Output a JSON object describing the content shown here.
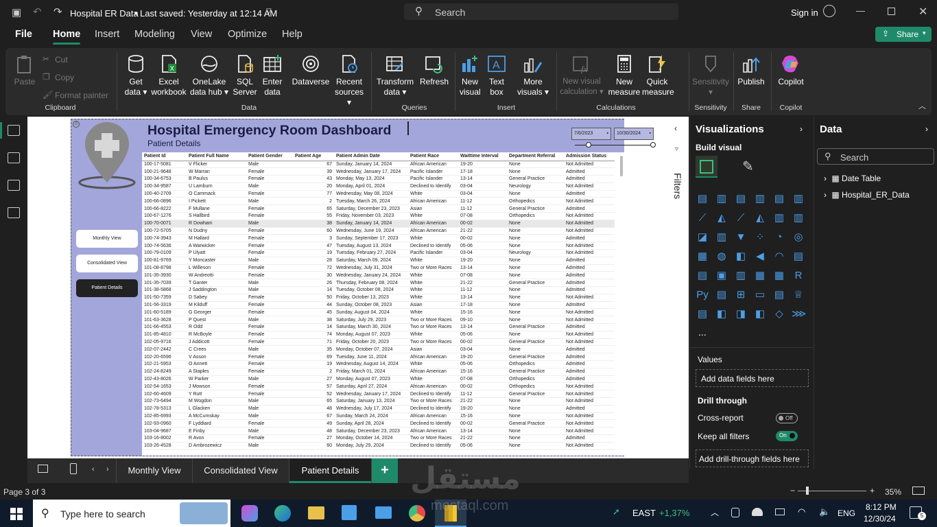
{
  "app": {
    "file_title": "Hospital ER Data",
    "save_status": "Last saved: Yesterday at 12:14 AM",
    "search_placeholder": "Search",
    "sign_in": "Sign in"
  },
  "menu": [
    "File",
    "Home",
    "Insert",
    "Modeling",
    "View",
    "Optimize",
    "Help"
  ],
  "share_label": "Share",
  "ribbon": {
    "clipboard": {
      "paste": "Paste",
      "cut": "Cut",
      "copy": "Copy",
      "format_painter": "Format painter",
      "group": "Clipboard"
    },
    "data": {
      "items": [
        {
          "l1": "Get",
          "l2": "data ▾"
        },
        {
          "l1": "Excel",
          "l2": "workbook"
        },
        {
          "l1": "OneLake",
          "l2": "data hub ▾"
        },
        {
          "l1": "SQL",
          "l2": "Server"
        },
        {
          "l1": "Enter",
          "l2": "data"
        },
        {
          "l1": "Dataverse",
          "l2": ""
        },
        {
          "l1": "Recent",
          "l2": "sources ▾"
        }
      ],
      "group": "Data"
    },
    "queries": {
      "items": [
        {
          "l1": "Transform",
          "l2": "data ▾"
        },
        {
          "l1": "Refresh",
          "l2": ""
        }
      ],
      "group": "Queries"
    },
    "insert": {
      "items": [
        {
          "l1": "New",
          "l2": "visual"
        },
        {
          "l1": "Text",
          "l2": "box"
        },
        {
          "l1": "More",
          "l2": "visuals ▾"
        }
      ],
      "group": "Insert"
    },
    "calculations": {
      "items": [
        {
          "l1": "New visual",
          "l2": "calculation ▾"
        },
        {
          "l1": "New",
          "l2": "measure"
        },
        {
          "l1": "Quick",
          "l2": "measure"
        }
      ],
      "group": "Calculations"
    },
    "sensitivity": {
      "l1": "Sensitivity",
      "l2": "▾",
      "group": "Sensitivity"
    },
    "share": {
      "l1": "Publish",
      "group": "Share"
    },
    "copilot": {
      "l1": "Copilot",
      "group": "Copilot"
    }
  },
  "report": {
    "title": "Hospital Emergency Room Dashboard",
    "subtitle": "Patient Details",
    "date_from": "7/6/2023",
    "date_to": "10/30/2024",
    "nav_buttons": [
      "Monthly View",
      "Consolidated View",
      "Patient Details"
    ],
    "columns": [
      "Patient Id",
      "Patient Full Name",
      "Patient Gender",
      "Patient Age",
      "Patient Admin Date",
      "Patient Race",
      "Waittime Interval",
      "Department Referral",
      "Admission Status"
    ],
    "rows": [
      [
        "100-17-5081",
        "V Flicker",
        "Male",
        "67",
        "Sunday, January 14, 2024",
        "African American",
        "19-20",
        "None",
        "Not Admitted"
      ],
      [
        "100-21-9648",
        "W Marran",
        "Female",
        "39",
        "Wednesday, January 17, 2024",
        "Pacific Islander",
        "17-18",
        "None",
        "Admitted"
      ],
      [
        "100-34-6753",
        "B Paulus",
        "Female",
        "43",
        "Monday, May 13, 2024",
        "Pacific Islander",
        "13-14",
        "General Practice",
        "Admitted"
      ],
      [
        "100-34-9587",
        "U Lamburn",
        "Male",
        "20",
        "Monday, April 01, 2024",
        "Declined to Identify",
        "03-04",
        "Neurology",
        "Not Admitted"
      ],
      [
        "100-40-2709",
        "O Cammack",
        "Female",
        "77",
        "Wednesday, May 08, 2024",
        "White",
        "03-04",
        "None",
        "Admitted"
      ],
      [
        "100-66-0896",
        "I Pickett",
        "Male",
        "2",
        "Tuesday, March 26, 2024",
        "African American",
        "11-12",
        "Orthopedics",
        "Not Admitted"
      ],
      [
        "100-66-8222",
        "F Mullane",
        "Female",
        "65",
        "Saturday, December 23, 2023",
        "Asian",
        "11-12",
        "General Practice",
        "Admitted"
      ],
      [
        "100-67-1276",
        "S Hallbird",
        "Female",
        "55",
        "Friday, November 03, 2023",
        "White",
        "07-08",
        "Orthopedics",
        "Not Admitted"
      ],
      [
        "100-70-0071",
        "R Dowham",
        "Male",
        "38",
        "Sunday, January 14, 2024",
        "African American",
        "00-02",
        "None",
        "Not Admitted"
      ],
      [
        "100-72-5705",
        "N Dudny",
        "Female",
        "60",
        "Wednesday, June 19, 2024",
        "African American",
        "21-22",
        "None",
        "Not Admitted"
      ],
      [
        "100-74-3943",
        "M Hallard",
        "Female",
        "3",
        "Sunday, September 17, 2023",
        "White",
        "00-02",
        "None",
        "Admitted"
      ],
      [
        "100-74-5636",
        "A Warwicker",
        "Female",
        "47",
        "Tuesday, August 13, 2024",
        "Declined to Identify",
        "05-06",
        "None",
        "Not Admitted"
      ],
      [
        "100-79-0109",
        "P Ulyatt",
        "Female",
        "19",
        "Tuesday, February 27, 2024",
        "Pacific Islander",
        "03-04",
        "Neurology",
        "Not Admitted"
      ],
      [
        "100-81-9769",
        "Y Moncaster",
        "Male",
        "28",
        "Saturday, March 09, 2024",
        "White",
        "19-20",
        "None",
        "Admitted"
      ],
      [
        "101-08-8798",
        "L Willeson",
        "Female",
        "72",
        "Wednesday, July 31, 2024",
        "Two or More Races",
        "13-14",
        "None",
        "Admitted"
      ],
      [
        "101-35-3930",
        "W Andreotti",
        "Female",
        "30",
        "Wednesday, January 24, 2024",
        "White",
        "07-08",
        "None",
        "Admitted"
      ],
      [
        "101-35-7039",
        "T Ganter",
        "Male",
        "26",
        "Thursday, February 08, 2024",
        "White",
        "21-22",
        "General Practice",
        "Admitted"
      ],
      [
        "101-38-5868",
        "J Saddington",
        "Male",
        "14",
        "Tuesday, October 08, 2024",
        "White",
        "11-12",
        "None",
        "Admitted"
      ],
      [
        "101-50-7359",
        "D Sabey",
        "Female",
        "50",
        "Friday, October 13, 2023",
        "White",
        "13-14",
        "None",
        "Not Admitted"
      ],
      [
        "101-56-3319",
        "M Kilduff",
        "Female",
        "44",
        "Sunday, October 08, 2023",
        "Asian",
        "17-18",
        "None",
        "Admitted"
      ],
      [
        "101-60-5189",
        "G Georger",
        "Female",
        "45",
        "Sunday, August 04, 2024",
        "White",
        "15-16",
        "None",
        "Not Admitted"
      ],
      [
        "101-63-3628",
        "P Quest",
        "Male",
        "38",
        "Saturday, July 29, 2023",
        "Two or More Races",
        "09-10",
        "None",
        "Not Admitted"
      ],
      [
        "101-66-4553",
        "R Odd",
        "Female",
        "14",
        "Saturday, March 30, 2024",
        "Two or More Races",
        "13-14",
        "General Practice",
        "Admitted"
      ],
      [
        "101-85-4810",
        "R McBoyle",
        "Female",
        "74",
        "Monday, August 07, 2023",
        "White",
        "05-06",
        "None",
        "Not Admitted"
      ],
      [
        "102-05-9716",
        "J Addicott",
        "Female",
        "71",
        "Friday, October 20, 2023",
        "Two or More Races",
        "00-02",
        "General Practice",
        "Not Admitted"
      ],
      [
        "102-07-2442",
        "C Crees",
        "Male",
        "35",
        "Monday, October 07, 2024",
        "Asian",
        "03-04",
        "None",
        "Admitted"
      ],
      [
        "102-20-6596",
        "V Asson",
        "Female",
        "69",
        "Tuesday, June 11, 2024",
        "African American",
        "19-20",
        "General Practice",
        "Admitted"
      ],
      [
        "102-21-5953",
        "O Annett",
        "Female",
        "19",
        "Wednesday, August 14, 2024",
        "White",
        "05-06",
        "Orthopedics",
        "Admitted"
      ],
      [
        "102-24-8249",
        "A Staples",
        "Female",
        "2",
        "Friday, March 01, 2024",
        "African American",
        "15-16",
        "General Practice",
        "Admitted"
      ],
      [
        "102-43-8026",
        "W Parker",
        "Male",
        "27",
        "Monday, August 07, 2023",
        "White",
        "07-08",
        "Orthopedics",
        "Admitted"
      ],
      [
        "102-54-1653",
        "J Mowson",
        "Female",
        "57",
        "Saturday, April 27, 2024",
        "African American",
        "00-02",
        "Orthopedics",
        "Not Admitted"
      ],
      [
        "102-60-4609",
        "Y Rutt",
        "Female",
        "52",
        "Wednesday, January 17, 2024",
        "Declined to Identify",
        "11-12",
        "General Practice",
        "Not Admitted"
      ],
      [
        "102-73-6494",
        "M Wogdon",
        "Male",
        "65",
        "Saturday, January 13, 2024",
        "Two or More Races",
        "21-22",
        "None",
        "Not Admitted"
      ],
      [
        "102-78-5313",
        "L Glacken",
        "Male",
        "48",
        "Wednesday, July 17, 2024",
        "Declined to Identify",
        "19-20",
        "None",
        "Admitted"
      ],
      [
        "102-85-6993",
        "A McCumskay",
        "Male",
        "67",
        "Sunday, March 24, 2024",
        "African American",
        "15-16",
        "None",
        "Not Admitted"
      ],
      [
        "102-93-0960",
        "F Lyddiard",
        "Female",
        "49",
        "Sunday, April 28, 2024",
        "Declined to Identify",
        "00-02",
        "General Practice",
        "Not Admitted"
      ],
      [
        "103-04-9687",
        "E Finby",
        "Male",
        "48",
        "Saturday, December 23, 2023",
        "African American",
        "13-14",
        "None",
        "Not Admitted"
      ],
      [
        "103-16-8002",
        "R Avon",
        "Female",
        "27",
        "Monday, October 14, 2024",
        "Two or More Races",
        "21-22",
        "None",
        "Admitted"
      ],
      [
        "103-26-4528",
        "D Ambrozewicz",
        "Male",
        "60",
        "Monday, July 29, 2024",
        "Declined to Identify",
        "05-06",
        "None",
        "Not Admitted"
      ]
    ]
  },
  "filters_label": "Filters",
  "visualizations": {
    "title": "Visualizations",
    "build_visual": "Build visual",
    "values_label": "Values",
    "add_data_fields": "Add data fields here",
    "drill_through": "Drill through",
    "cross_report": "Cross-report",
    "cross_report_state": "Off",
    "keep_all_filters": "Keep all filters",
    "keep_all_filters_state": "On",
    "add_drill_through": "Add drill-through fields here",
    "more": "..."
  },
  "data_pane": {
    "title": "Data",
    "search_placeholder": "Search",
    "tables": [
      "Date Table",
      "Hospital_ER_Data"
    ]
  },
  "page_tabs": [
    "Monthly View",
    "Consolidated View",
    "Patient Details"
  ],
  "status": {
    "page": "Page 3 of 3",
    "zoom": "35%"
  },
  "taskbar": {
    "search_placeholder": "Type here to search",
    "ticker": "EAST",
    "ticker_change": "+1,37%",
    "lang": "ENG",
    "time": "8:12 PM",
    "date": "12/30/24",
    "notif_count": "5"
  },
  "watermark": {
    "arabic": "مستقل",
    "latin": "mostaql.com"
  },
  "colors": {
    "accent": "#1f8a6a",
    "report_bg": "#a3a6da",
    "icon_blue": "#4b9fe8"
  }
}
